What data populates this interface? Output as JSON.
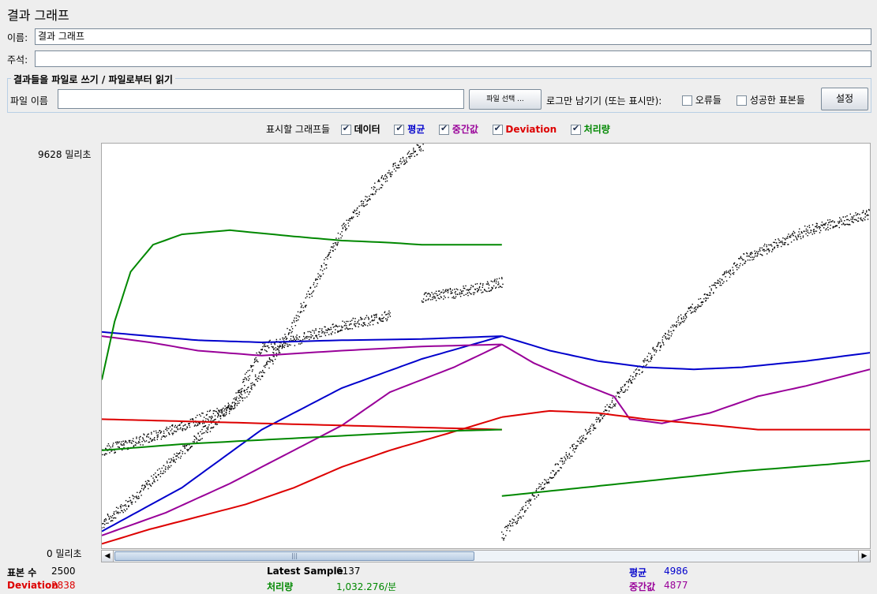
{
  "window": {
    "title": "결과 그래프"
  },
  "form": {
    "name_label": "이름:",
    "name_value": "결과 그래프",
    "comment_label": "주석:",
    "comment_value": ""
  },
  "file_group": {
    "title": "결과들을 파일로 쓰기 / 파일로부터 읽기",
    "filename_label": "파일 이름",
    "filename_value": "",
    "browse_label": "파일 선택 ...",
    "log_only_label": "로그만 남기기 (또는 표시만):",
    "errors_label": "오류들",
    "errors_checked": false,
    "success_label": "성공한 표본들",
    "success_checked": false,
    "settings_label": "설정"
  },
  "legend": {
    "label": "표시할 그래프들",
    "items": [
      {
        "label": "데이터",
        "checked": true,
        "color": "#000000"
      },
      {
        "label": "평균",
        "checked": true,
        "color": "#0000cc"
      },
      {
        "label": "중간값",
        "checked": true,
        "color": "#990099"
      },
      {
        "label": "Deviation",
        "checked": true,
        "color": "#dd0000"
      },
      {
        "label": "처리량",
        "checked": true,
        "color": "#008800"
      }
    ]
  },
  "chart_data": {
    "type": "line",
    "y_max_label": "9628 밀리초",
    "y_min_label": "0 밀리초",
    "ylim": [
      0,
      9628
    ],
    "xlim": [
      0,
      2500
    ],
    "grid": false,
    "series": [
      {
        "name": "데이터",
        "color": "#000000",
        "style": "dots",
        "segments": [
          [
            [
              0,
              550
            ],
            [
              150,
              1000
            ],
            [
              300,
              1550
            ],
            [
              500,
              2300
            ],
            [
              700,
              3000
            ],
            [
              900,
              3700
            ],
            [
              1100,
              4700
            ],
            [
              1300,
              6100
            ],
            [
              1500,
              7600
            ],
            [
              1700,
              8600
            ],
            [
              1850,
              9200
            ],
            [
              2000,
              9628
            ]
          ],
          [
            [
              0,
              2300
            ],
            [
              200,
              2500
            ],
            [
              400,
              2750
            ],
            [
              600,
              3050
            ],
            [
              800,
              3300
            ],
            [
              1000,
              4800
            ],
            [
              1200,
              4950
            ],
            [
              1450,
              5250
            ],
            [
              1600,
              5400
            ],
            [
              1800,
              5550
            ]
          ],
          [
            [
              2000,
              6000
            ],
            [
              2200,
              6100
            ],
            [
              2400,
              6250
            ],
            [
              2500,
              6350
            ]
          ],
          [
            [
              2500,
              250
            ],
            [
              2800,
              1700
            ],
            [
              3200,
              3500
            ],
            [
              3600,
              5400
            ],
            [
              4000,
              6900
            ],
            [
              4400,
              7600
            ],
            [
              4800,
              8000
            ]
          ]
        ]
      },
      {
        "name": "평균",
        "color": "#0000cc",
        "style": "line",
        "segments": [
          [
            [
              0,
              5150
            ],
            [
              300,
              5050
            ],
            [
              600,
              4950
            ],
            [
              1000,
              4900
            ],
            [
              1500,
              4950
            ],
            [
              2000,
              4980
            ],
            [
              2500,
              5050
            ]
          ],
          [
            [
              2500,
              5050
            ],
            [
              2800,
              4700
            ],
            [
              3100,
              4450
            ],
            [
              3400,
              4300
            ],
            [
              3700,
              4250
            ],
            [
              4000,
              4300
            ],
            [
              4400,
              4450
            ],
            [
              4800,
              4650
            ]
          ],
          [
            [
              0,
              350
            ],
            [
              500,
              1400
            ],
            [
              1000,
              2800
            ],
            [
              1500,
              3800
            ],
            [
              2000,
              4500
            ],
            [
              2500,
              5050
            ]
          ]
        ]
      },
      {
        "name": "중간값",
        "color": "#990099",
        "style": "line",
        "segments": [
          [
            [
              0,
              5050
            ],
            [
              300,
              4900
            ],
            [
              600,
              4700
            ],
            [
              1000,
              4580
            ],
            [
              1500,
              4700
            ],
            [
              2000,
              4800
            ],
            [
              2500,
              4850
            ]
          ],
          [
            [
              2500,
              4850
            ],
            [
              2700,
              4400
            ],
            [
              3000,
              3900
            ],
            [
              3200,
              3600
            ],
            [
              3300,
              3050
            ],
            [
              3500,
              2950
            ],
            [
              3800,
              3200
            ],
            [
              4100,
              3600
            ],
            [
              4400,
              3850
            ],
            [
              4800,
              4250
            ]
          ],
          [
            [
              0,
              250
            ],
            [
              400,
              800
            ],
            [
              800,
              1500
            ],
            [
              1200,
              2300
            ],
            [
              1500,
              2900
            ],
            [
              1800,
              3700
            ],
            [
              2200,
              4300
            ],
            [
              2500,
              4850
            ]
          ]
        ]
      },
      {
        "name": "Deviation",
        "color": "#dd0000",
        "style": "line",
        "segments": [
          [
            [
              0,
              3050
            ],
            [
              500,
              3000
            ],
            [
              1000,
              2950
            ],
            [
              1500,
              2900
            ],
            [
              2000,
              2850
            ],
            [
              2500,
              2800
            ]
          ],
          [
            [
              0,
              50
            ],
            [
              300,
              400
            ],
            [
              600,
              700
            ],
            [
              900,
              1000
            ],
            [
              1200,
              1400
            ],
            [
              1500,
              1900
            ],
            [
              1800,
              2300
            ],
            [
              2200,
              2750
            ],
            [
              2500,
              3100
            ]
          ],
          [
            [
              2500,
              3100
            ],
            [
              2800,
              3250
            ],
            [
              3100,
              3200
            ],
            [
              3400,
              3050
            ],
            [
              3700,
              2950
            ],
            [
              4100,
              2800
            ],
            [
              4500,
              2800
            ],
            [
              4800,
              2800
            ]
          ]
        ]
      },
      {
        "name": "처리량",
        "color": "#008800",
        "style": "line",
        "segments": [
          [
            [
              0,
              2300
            ],
            [
              500,
              2450
            ],
            [
              1000,
              2550
            ],
            [
              1500,
              2650
            ],
            [
              2000,
              2750
            ],
            [
              2500,
              2800
            ]
          ],
          [
            [
              2500,
              1200
            ],
            [
              3000,
              1400
            ],
            [
              3500,
              1600
            ],
            [
              4000,
              1800
            ],
            [
              4500,
              1950
            ],
            [
              4800,
              2050
            ]
          ],
          [
            [
              0,
              4000
            ],
            [
              80,
              5400
            ],
            [
              180,
              6600
            ],
            [
              320,
              7250
            ],
            [
              500,
              7500
            ],
            [
              800,
              7600
            ],
            [
              1200,
              7450
            ],
            [
              1500,
              7350
            ],
            [
              1800,
              7300
            ],
            [
              2000,
              7250
            ],
            [
              2500,
              7250
            ]
          ]
        ]
      }
    ]
  },
  "stats": {
    "samples_label": "표본 수",
    "samples_value": "2500",
    "latest_label": "Latest Sample",
    "latest_value": "6137",
    "average_label": "평균",
    "average_value": "4986",
    "deviation_label": "Deviation",
    "deviation_value": "2838",
    "throughput_label": "처리량",
    "throughput_value": "1,032.276/분",
    "median_label": "중간값",
    "median_value": "4877"
  },
  "colors": {
    "average": "#0000cc",
    "median": "#990099",
    "deviation": "#dd0000",
    "throughput": "#008800"
  }
}
